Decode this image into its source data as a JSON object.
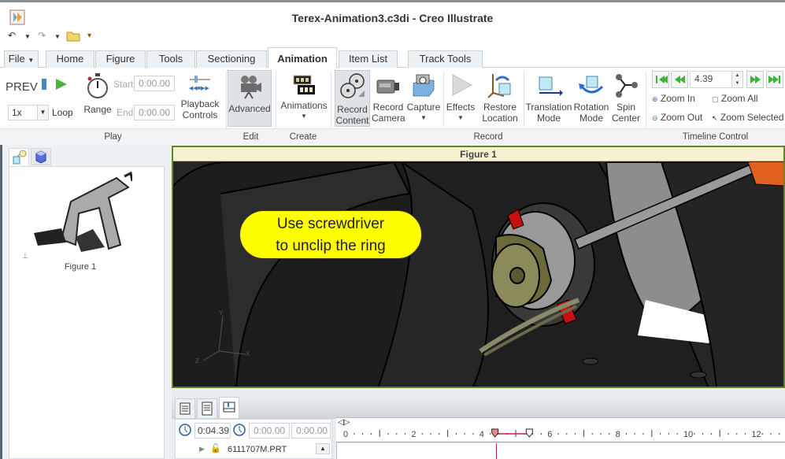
{
  "window": {
    "title": "Terex-Animation3.c3di - Creo Illustrate"
  },
  "quick_access": [
    "undo-icon",
    "redo-icon",
    "open-folder-icon",
    "customize-icon"
  ],
  "tabs": [
    {
      "label": "File",
      "dropdown": true
    },
    {
      "label": "Home"
    },
    {
      "label": "Figure"
    },
    {
      "label": "Tools"
    },
    {
      "label": "Sectioning"
    },
    {
      "label": "Animation",
      "active": true
    },
    {
      "label": "Item List"
    },
    {
      "label": "Track Tools"
    }
  ],
  "ribbon": {
    "play": {
      "group_label": "Play",
      "prev_label": "PREV",
      "speed_value": "1x",
      "loop_label": "Loop",
      "range_label": "Range",
      "start_label": "Start:",
      "start_value": "0:00.00",
      "end_label": "End:",
      "end_value": "0:00.00",
      "playback_label_1": "Playback",
      "playback_label_2": "Controls"
    },
    "edit": {
      "group_label": "Edit",
      "advanced_label": "Advanced"
    },
    "create": {
      "group_label": "Create",
      "animations_label": "Animations"
    },
    "record": {
      "group_label": "Record",
      "record_content_1": "Record",
      "record_content_2": "Content",
      "record_camera_1": "Record",
      "record_camera_2": "Camera",
      "capture_label": "Capture",
      "effects_label": "Effects",
      "restore_1": "Restore",
      "restore_2": "Location",
      "translation_1": "Translation",
      "translation_2": "Mode",
      "rotation_1": "Rotation",
      "rotation_2": "Mode",
      "spin_1": "Spin",
      "spin_2": "Center"
    },
    "timeline": {
      "group_label": "Timeline Control",
      "time_value": "4.39",
      "zoom_in": "Zoom In",
      "zoom_all": "Zoom All",
      "zoom_out": "Zoom Out",
      "zoom_selected": "Zoom Selected"
    }
  },
  "left_panel": {
    "tabs": [
      "structure-icon",
      "3d-view-icon"
    ],
    "thumbnail_label": "Figure 1"
  },
  "viewport": {
    "title": "Figure 1",
    "callout_line1": "Use screwdriver",
    "callout_line2": "to unclip the ring",
    "axis_labels": [
      "Y",
      "Z",
      "X"
    ]
  },
  "timeline_panel": {
    "current_time": "0:04.39",
    "start_time": "0:00.00",
    "end_time": "0:00.00",
    "track_item": "6111707M.PRT",
    "ruler_labels": [
      "0",
      "2",
      "4",
      "6",
      "8",
      "10",
      "12"
    ],
    "playhead_value": 4.39,
    "selection_start": 4.39,
    "selection_end": 5.4,
    "highlight_color": "#c0283a"
  },
  "colors": {
    "accent_green": "#5c8a1e",
    "callout_yellow": "#ffff00",
    "viewport_bg": "#242424"
  }
}
